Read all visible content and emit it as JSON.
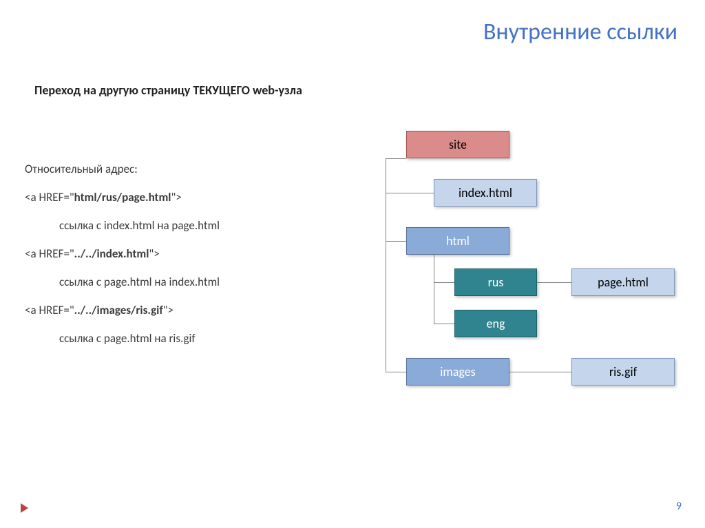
{
  "title": "Внутренние ссылки",
  "subtitle": "Переход на другую страницу ТЕКУЩЕГО web-узла",
  "left": {
    "rel_addr_label": "Относительный адрес:",
    "ex1_code_prefix": "<a HREF=\"",
    "ex1_code_bold": "html/rus/page.html",
    "ex1_code_suffix": "\">",
    "ex1_caption": "ссылка с index.html на page.html",
    "ex2_code_prefix": "<a HREF=\"",
    "ex2_code_bold": "../../index.html",
    "ex2_code_suffix": "\">",
    "ex2_caption": "ссылка с page.html на index.html",
    "ex3_code_prefix": "<a HREF=\"",
    "ex3_code_bold": "../../images/ris.gif",
    "ex3_code_suffix": "\">",
    "ex3_caption": "ссылка с page.html на ris.gif"
  },
  "diagram": {
    "site": "site",
    "index": "index.html",
    "html": "html",
    "rus": "rus",
    "eng": "eng",
    "page": "page.html",
    "images": "images",
    "ris": "ris.gif"
  },
  "page_number": "9"
}
